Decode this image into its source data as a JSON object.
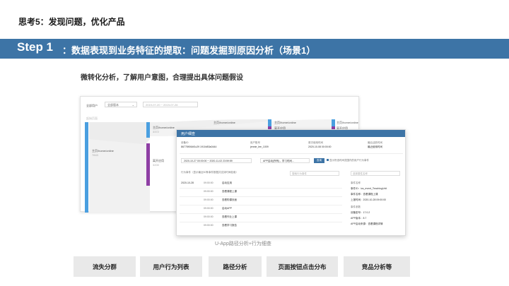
{
  "header": {
    "top_title": "思考5：发现问题，优化产品",
    "step_label": "Step 1",
    "step_text": "：数据表现到业务特征的提取：问题发掘到原因分析（场景1）",
    "sub_title": "微转化分析，了解用户意图，合理提出具体问题假设"
  },
  "sankey_shot": {
    "filter_label": "全部用户",
    "filter_select": "全部版本",
    "date_range": "2019-07-20 ~ 2019-07-26",
    "start_label": "起始页面",
    "node_main": "主页/home/online",
    "node_main_count": "7843",
    "node_main2": "主页/home/online",
    "node_main2_count": "3372",
    "node_other": "离开应用",
    "node_other_count": "3200",
    "node_r1": "主页/home/online",
    "node_r2": "离开应用",
    "node_r3": "主页/home/online",
    "node_r4": "离开应用",
    "colors": {
      "blue": "#4a9fe0",
      "purple": "#8e3fa4",
      "flow": "#e8e8e8"
    }
  },
  "detail_shot": {
    "panel_title": "用户细查",
    "fields": [
      {
        "label": "设备ID",
        "value": "867789064f1c29 1910d53a0444"
      },
      {
        "label": "用户账号",
        "value": "jennie_lee_1009"
      },
      {
        "label": "首次使用时间",
        "value": "2020-10-08 00:00:00"
      },
      {
        "label": "最后活跃时间",
        "value": "最近使用时间"
      }
    ],
    "date_from": "2020-10-27 00:00:00",
    "date_to": "2020-11-02 23:59:59",
    "event_select": "APP启动(所有)，学习时间...",
    "query_button": "查询",
    "checkbox_label": "显示所选时间范围内的用户行为事件",
    "list_header": "行为事件（显示最近50条事件数据并支持时间检索）",
    "search_placeholder": "搜索行为事件",
    "right_search_placeholder": "选择属性名称",
    "events_date": "2020-10-28",
    "events": [
      {
        "time": "09:00:00",
        "name": "启动应用"
      },
      {
        "time": "09:00:00",
        "name": "查看课程上课"
      },
      {
        "time": "09:00:00",
        "name": "查看购课页面"
      },
      {
        "time": "09:00:00",
        "name": "启动APP"
      },
      {
        "time": "09:00:00",
        "name": "查看作业上课"
      },
      {
        "time": "09:00:00",
        "name": "查看学习报告"
      }
    ],
    "props": [
      "事件名称",
      "事件ID：ios_event_TeachingUnit",
      "事件名称：查看课程上课",
      "上报时间：2020-10-28 09:00:00",
      "事件参数",
      "设备型号：17.0.2",
      "APP版本：8.7",
      "APP启动来源：查看课程详情"
    ]
  },
  "caption": "U-App路径分析+行为细查",
  "buttons": [
    "流失分群",
    "用户行为列表",
    "路径分析",
    "页面按钮点击分布",
    "竞品分析等"
  ]
}
